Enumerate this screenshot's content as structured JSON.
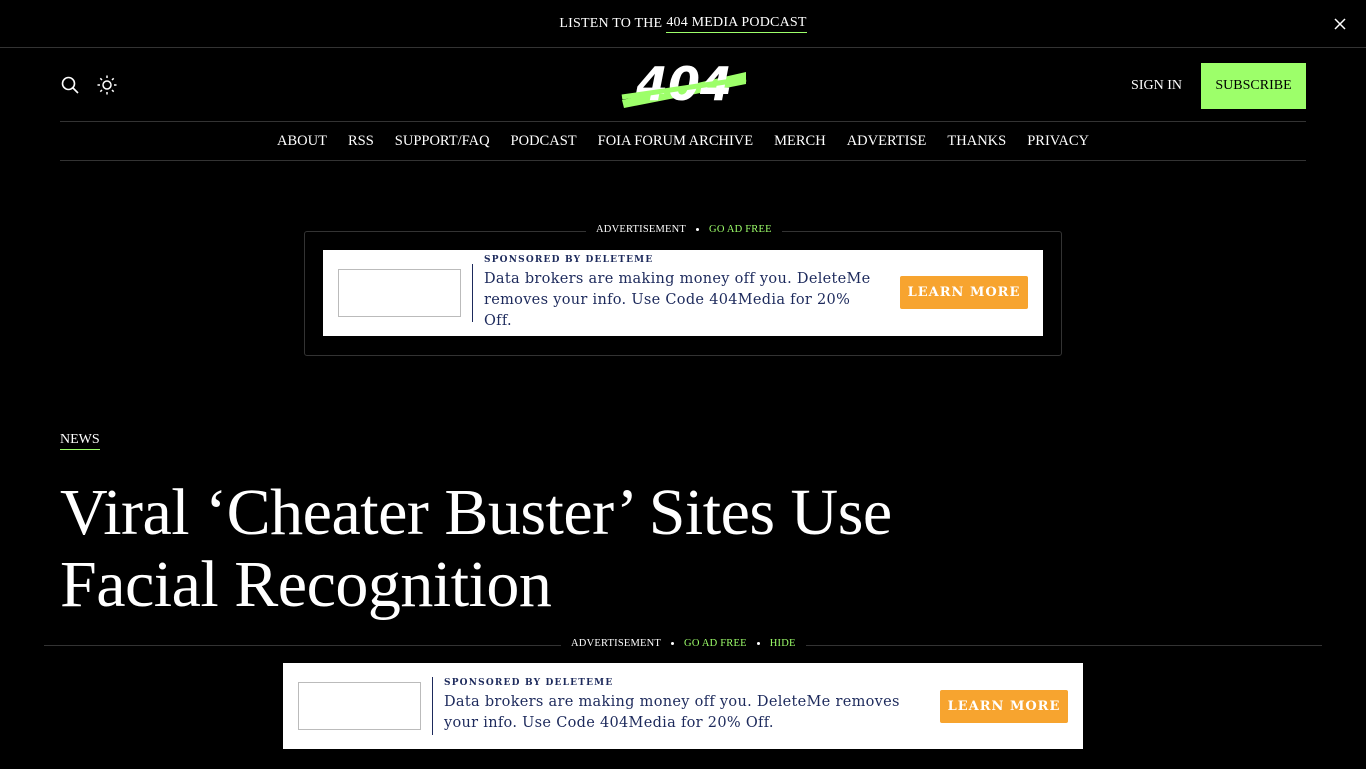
{
  "topbar": {
    "prefix": "LISTEN TO THE",
    "link": "404 MEDIA PODCAST"
  },
  "header": {
    "logo_text": "404",
    "sign_in": "SIGN IN",
    "subscribe": "SUBSCRIBE",
    "brand_color": "#9dff6a"
  },
  "nav": [
    "ABOUT",
    "RSS",
    "SUPPORT/FAQ",
    "PODCAST",
    "FOIA FORUM ARCHIVE",
    "MERCH",
    "ADVERTISE",
    "THANKS",
    "PRIVACY"
  ],
  "ad_top": {
    "label": "ADVERTISEMENT",
    "go_ad_free": "GO AD FREE",
    "sponsored": "SPONSORED BY DELETEME",
    "body": "Data brokers are making money off you. DeleteMe removes your info. Use Code 404Media for 20% Off.",
    "cta": "LEARN MORE"
  },
  "article": {
    "tag": "NEWS",
    "title": "Viral ‘Cheater Buster’ Sites Use Facial Recognition"
  },
  "ad_bottom": {
    "label": "ADVERTISEMENT",
    "go_ad_free": "GO AD FREE",
    "hide": "HIDE",
    "sponsored": "SPONSORED BY DELETEME",
    "body": "Data brokers are making money off you. DeleteMe removes your info. Use Code 404Media for 20% Off.",
    "cta": "LEARN MORE",
    "cta_color": "#f7a42f"
  }
}
